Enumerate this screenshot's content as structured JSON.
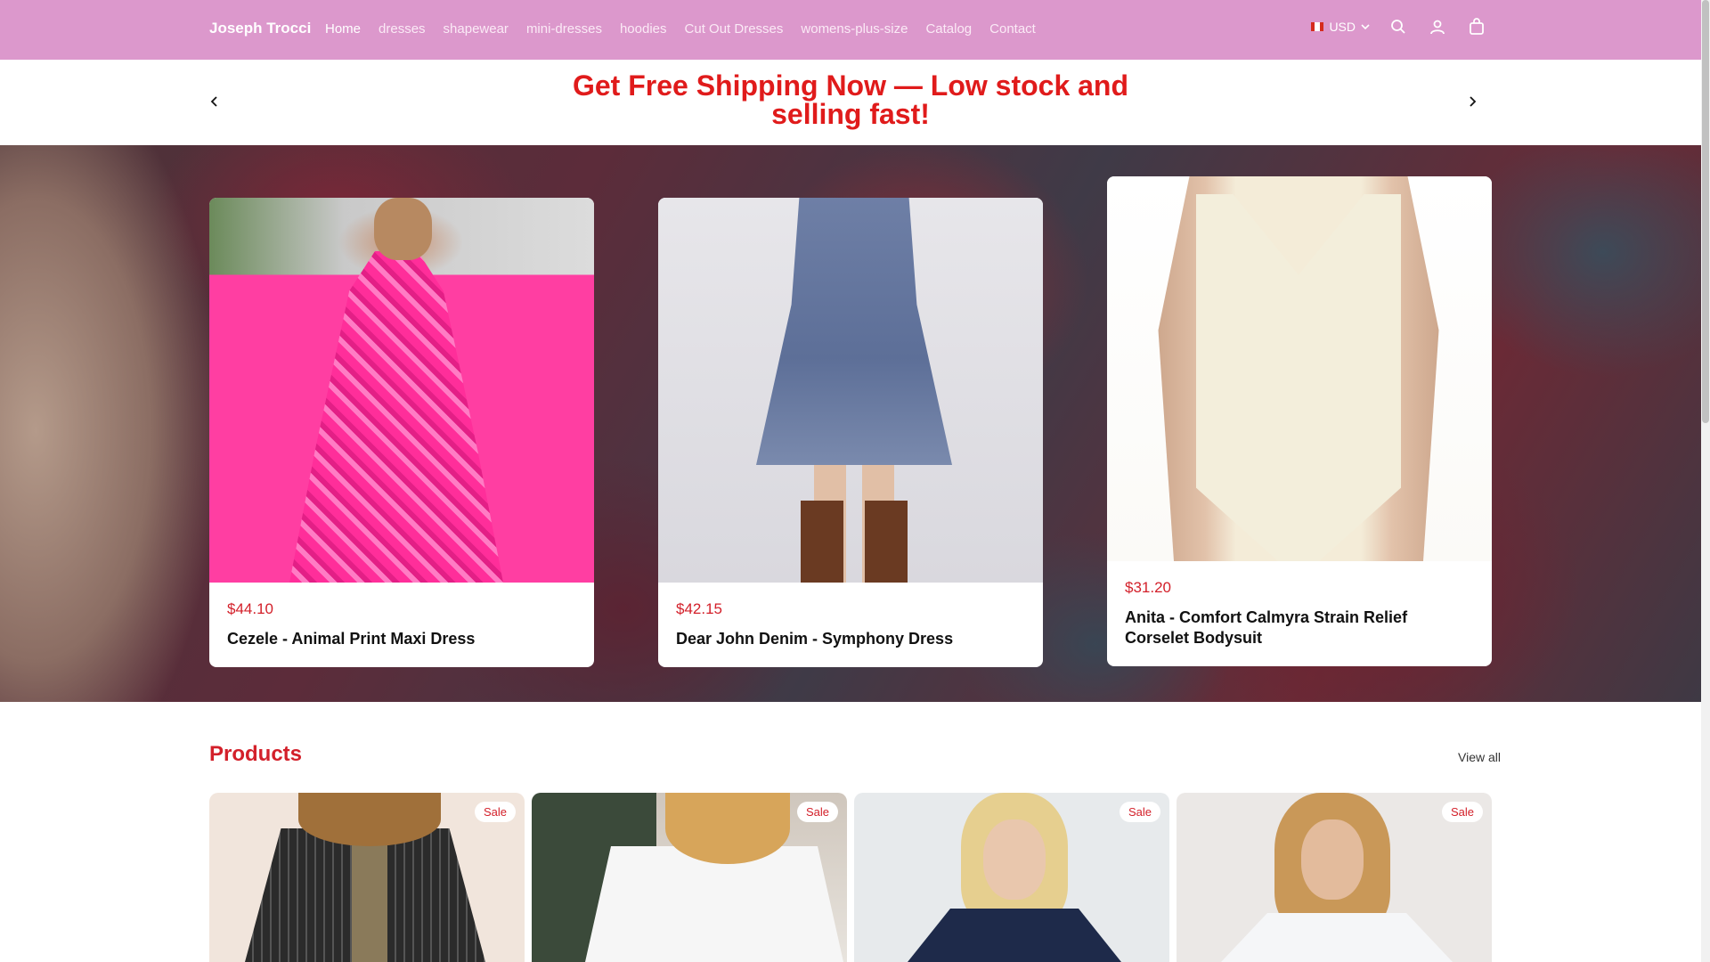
{
  "header": {
    "brand": "Joseph Trocci",
    "nav": [
      "Home",
      "dresses",
      "shapewear",
      "mini-dresses",
      "hoodies",
      "Cut Out Dresses",
      "womens-plus-size",
      "Catalog",
      "Contact"
    ],
    "currency": "USD",
    "bg_color": "#dc98cc"
  },
  "announcement": {
    "text": "Get Free Shipping Now — Low stock and selling fast!",
    "color": "#e01b1b"
  },
  "hero_cards": [
    {
      "price": "$44.10",
      "title": "Cezele - Animal Print Maxi Dress"
    },
    {
      "price": "$42.15",
      "title": "Dear John Denim - Symphony Dress"
    },
    {
      "price": "$31.20",
      "title": "Anita - Comfort Calmyra Strain Relief Corselet Bodysuit"
    }
  ],
  "products": {
    "title": "Products",
    "view_all": "View all",
    "badges": [
      "Sale",
      "Sale",
      "Sale",
      "Sale"
    ]
  },
  "colors": {
    "price_red": "#d3202a",
    "accent_pink": "#dc98cc"
  }
}
